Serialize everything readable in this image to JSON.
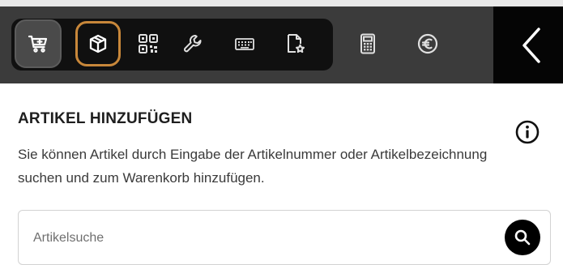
{
  "toolbar": {
    "tools": [
      {
        "icon": "cart-icon",
        "selected_style": "hover"
      },
      {
        "icon": "box-icon",
        "active": true
      },
      {
        "icon": "multi-box-icon"
      },
      {
        "icon": "wrench-icon"
      },
      {
        "icon": "keyboard-icon"
      },
      {
        "icon": "document-star-icon"
      },
      {
        "icon": "calculator-icon"
      },
      {
        "icon": "euro-icon"
      }
    ],
    "back_icon": "chevron-left-icon",
    "colors": {
      "bar": "#3b3b3b",
      "group": "#101010",
      "active_border": "#c8873a",
      "back_bg": "#050505"
    }
  },
  "section": {
    "title": "ARTIKEL HINZUFÜGEN",
    "description": "Sie können Artikel durch Eingabe der Artikelnummer oder Artikelbezeichnung suchen und zum Warenkorb hinzufügen.",
    "info_icon": "info-icon"
  },
  "search": {
    "placeholder": "Artikelsuche",
    "value": "",
    "button_icon": "search-icon"
  }
}
